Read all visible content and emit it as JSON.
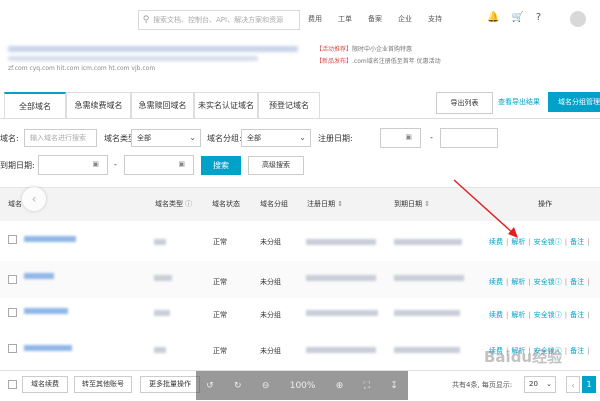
{
  "topbar": {
    "search_placeholder": "搜索文档、控制台、API、解决方案和资源",
    "nav": [
      "费用",
      "工单",
      "备案",
      "企业",
      "支持"
    ]
  },
  "banner": {
    "tlds": "zf.com  cyq.com  hit.com  icm.com  ht.com  vjb.com",
    "promo_line1_highlight": "【活动推荐】",
    "promo_line1": "限时中小企业首购特惠",
    "promo_line2_highlight": "【新品发布】",
    "promo_line2": ".com域名注册低至首年 优惠活动"
  },
  "tabs": [
    {
      "label": "全部域名",
      "active": true
    },
    {
      "label": "急需续费域名",
      "active": false
    },
    {
      "label": "急需赎回域名",
      "active": false
    },
    {
      "label": "未实名认证域名",
      "active": false
    },
    {
      "label": "预登记域名",
      "active": false
    }
  ],
  "toolbar": {
    "export_list": "导出列表",
    "view_export_results": "查看导出结果",
    "domain_group_manage": "域名分组管理"
  },
  "filters": {
    "domain_label": "域名:",
    "domain_placeholder": "输入域名进行搜索",
    "type_label": "域名类型:",
    "type_value": "全部",
    "group_label": "域名分组:",
    "group_value": "全部",
    "reg_date_label": "注册日期:",
    "exp_date_label": "到期日期:",
    "dash": "-",
    "search_button": "搜索",
    "advanced_search_button": "高级搜索"
  },
  "table": {
    "headers": {
      "domain": "域名",
      "type": "域名类型",
      "status": "域名状态",
      "group": "域名分组",
      "reg_date": "注册日期",
      "exp_date": "到期日期",
      "actions": "操作"
    },
    "rows": [
      {
        "status": "正常",
        "group": "未分组",
        "reg_date_partial": "2020-00-10 10:00:00",
        "exp_date_partial": "2021-"
      },
      {
        "status": "正常",
        "group": "未分组",
        "reg_date_partial": "",
        "exp_date_partial": ""
      },
      {
        "status": "正常",
        "group": "未分组",
        "reg_date_partial": "",
        "exp_date_partial": ""
      },
      {
        "status": "正常",
        "group": "未分组",
        "reg_date_partial": "",
        "exp_date_partial": "2020-"
      }
    ],
    "actions": {
      "renew": "续费",
      "resolve": "解析",
      "security_lock": "安全锁",
      "remark": "备注"
    },
    "type_partial": "TLD"
  },
  "footer": {
    "renew_button": "域名续费",
    "transfer_button": "转至其他账号",
    "batch_button": "更多批量操作",
    "total_text": "共有4条, 每页显示:",
    "page_size": "20",
    "current_page": "1",
    "zoom": "100%"
  },
  "watermark": "Baidu经验",
  "colors": {
    "accent": "#00a2ca",
    "arrow": "#e02020"
  }
}
